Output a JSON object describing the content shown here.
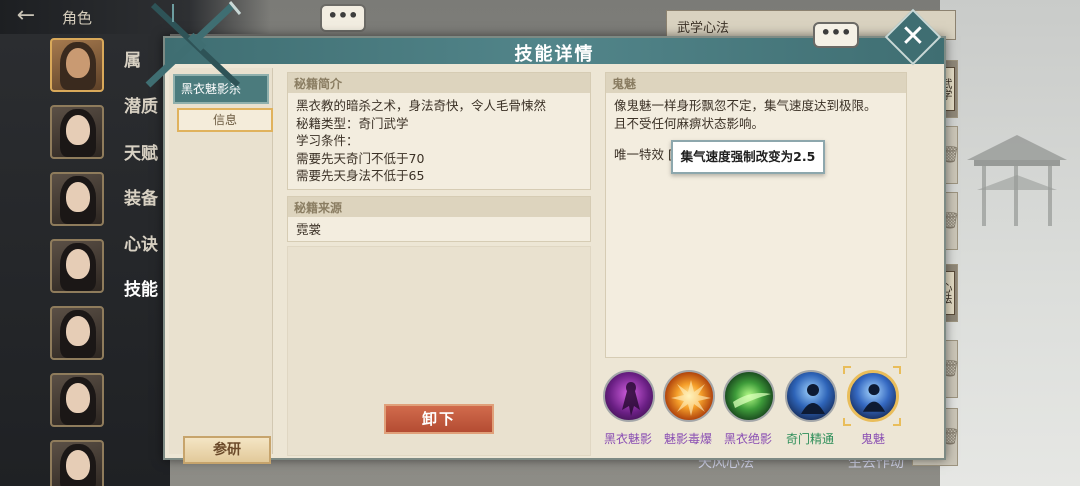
{
  "topbar": {
    "back_icon": "arrow-left-icon",
    "title": "角色"
  },
  "side_tabs": [
    "属",
    "潜质",
    "天赋",
    "装备",
    "心诀",
    "技能"
  ],
  "active_side_tab": "技能",
  "bubbles": {
    "top_chat": "•••",
    "modal_chat": "•••"
  },
  "right_panel": {
    "header": "武学心法",
    "slot_tags": [
      "武学",
      "心法"
    ],
    "bottom_buttons": [
      "天风心法",
      "生去作动"
    ]
  },
  "modal": {
    "title": "技能详情",
    "close_icon": "close-icon",
    "skill_list": {
      "selected": "黑衣魅影杀",
      "info_tab": "信息"
    },
    "research_button": "参研",
    "unequip_button": "卸下",
    "intro": {
      "heading": "秘籍简介",
      "lines": [
        "黑衣教的暗杀之术，身法奇快，令人毛骨悚然",
        "秘籍类型：奇门武学",
        "学习条件：",
        "需要先天奇门不低于70",
        "需要先天身法不低于65"
      ]
    },
    "source": {
      "heading": "秘籍来源",
      "value": "霓裳"
    },
    "detail": {
      "heading": "鬼魅",
      "lines": [
        "像鬼魅一样身形飘忽不定，集气速度达到极限。",
        "且不受任何麻痹状态影响。"
      ],
      "unique_label": "唯一特效",
      "unique_bracket": "[",
      "tooltip": "集气速度强制改变为2.5"
    },
    "skills": [
      {
        "name": "黑衣魅影",
        "color": "#8a4fb3",
        "icon": "shadow-figure-icon",
        "selected": false
      },
      {
        "name": "魅影毒爆",
        "color": "#8a4fb3",
        "icon": "explosion-icon",
        "selected": false
      },
      {
        "name": "黑衣绝影",
        "color": "#8a4fb3",
        "icon": "shadow-strike-icon",
        "selected": false
      },
      {
        "name": "奇门精通",
        "color": "#2f8f5a",
        "icon": "meditation-icon",
        "selected": false
      },
      {
        "name": "鬼魅",
        "color": "#8a4fb3",
        "icon": "ghost-icon",
        "selected": true
      }
    ]
  }
}
